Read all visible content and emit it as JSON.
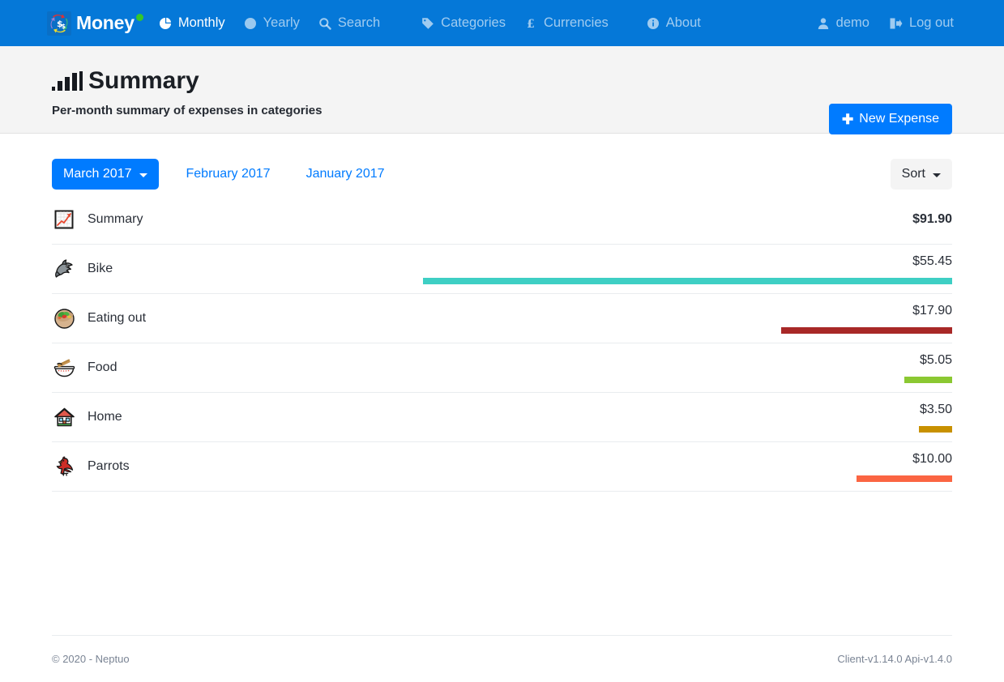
{
  "navbar": {
    "brand": {
      "label": "Money",
      "logo_icon": "currency-exchange-icon",
      "badge_color": "#35c72b"
    },
    "background_color": "#0578d8",
    "items": [
      {
        "label": "Monthly",
        "icon": "pie-chart-icon",
        "active": true
      },
      {
        "label": "Yearly",
        "icon": "circle-icon",
        "active": false
      },
      {
        "label": "Search",
        "icon": "magnifier-icon",
        "active": false
      },
      {
        "label": "Categories",
        "icon": "tag-icon",
        "active": false
      },
      {
        "label": "Currencies",
        "icon": "pound-sterling-icon",
        "active": false
      },
      {
        "label": "About",
        "icon": "info-circle-icon",
        "active": false
      }
    ],
    "right_items": [
      {
        "label": "demo",
        "icon": "user-icon"
      },
      {
        "label": "Log out",
        "icon": "sign-out-icon"
      }
    ]
  },
  "header": {
    "title": "Summary",
    "title_icon": "bar-chart-icon",
    "subtitle": "Per-month summary of expenses in categories",
    "new_expense_button": {
      "label": "New Expense",
      "icon": "plus-icon",
      "color": "#007bff"
    }
  },
  "toolbar": {
    "active_month": "March 2017",
    "months": [
      {
        "label": "February 2017"
      },
      {
        "label": "January 2017"
      }
    ],
    "sort_label": "Sort"
  },
  "summary": {
    "label": "Summary",
    "icon": "chart-increasing-icon",
    "amount": "$91.90"
  },
  "chart_data": {
    "type": "bar",
    "title": "Summary",
    "orientation": "horizontal",
    "xlabel": "",
    "ylabel": "",
    "grid": false,
    "legend": false,
    "total_label": "Summary",
    "total": 91.9,
    "total_formatted": "$91.90",
    "max_value": 55.45,
    "categories": [
      "Bike",
      "Eating out",
      "Food",
      "Home",
      "Parrots"
    ],
    "values": [
      55.45,
      17.9,
      5.05,
      3.5,
      10.0
    ],
    "value_labels": [
      "$55.45",
      "$17.90",
      "$5.05",
      "$3.50",
      "$10.00"
    ],
    "colors": [
      "#3ecfc4",
      "#a82827",
      "#8bc832",
      "#c89100",
      "#fb6542"
    ],
    "icons": [
      "shark-icon",
      "stuffed-flatbread-icon",
      "steaming-bowl-icon",
      "house-icon",
      "bird-icon"
    ]
  },
  "rows": [
    {
      "label": "Bike",
      "amount": "$55.45",
      "value": 55.45,
      "color": "#3ecfc4",
      "icon": "shark-icon"
    },
    {
      "label": "Eating out",
      "amount": "$17.90",
      "value": 17.9,
      "color": "#a82827",
      "icon": "stuffed-flatbread-icon"
    },
    {
      "label": "Food",
      "amount": "$5.05",
      "value": 5.05,
      "color": "#8bc832",
      "icon": "steaming-bowl-icon"
    },
    {
      "label": "Home",
      "amount": "$3.50",
      "value": 3.5,
      "color": "#c89100",
      "icon": "house-icon"
    },
    {
      "label": "Parrots",
      "amount": "$10.00",
      "value": 10.0,
      "color": "#fb6542",
      "icon": "bird-icon"
    }
  ],
  "footer": {
    "copyright": "© 2020 - Neptuo",
    "versions": "Client-v1.14.0 Api-v1.4.0"
  }
}
